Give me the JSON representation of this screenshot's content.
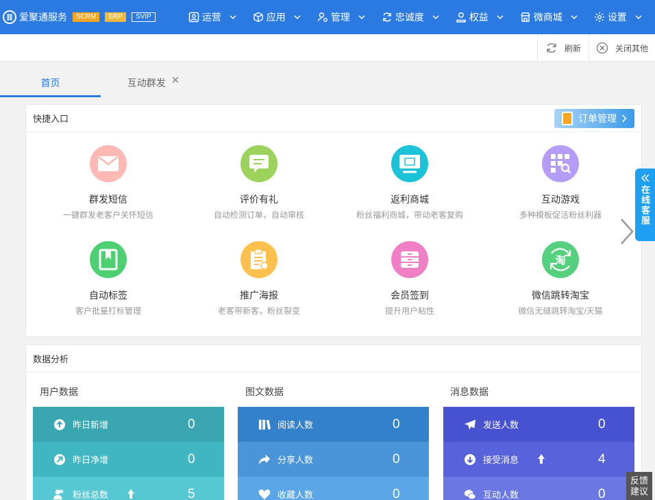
{
  "app": {
    "brand": "爱聚通服务",
    "badges": [
      "SCRM",
      "ERP",
      "SVIP"
    ]
  },
  "nav": [
    {
      "label": "运营",
      "icon": "user-card-icon"
    },
    {
      "label": "应用",
      "icon": "cube-icon"
    },
    {
      "label": "管理",
      "icon": "user-gear-icon"
    },
    {
      "label": "忠诚度",
      "icon": "refresh-icon"
    },
    {
      "label": "权益",
      "icon": "user-icon"
    },
    {
      "label": "微商城",
      "icon": "store-icon"
    },
    {
      "label": "设置",
      "icon": "gear-icon"
    }
  ],
  "toolbar": {
    "refresh_label": "刷新",
    "close_others_label": "关闭其他"
  },
  "tabs": [
    {
      "label": "首页",
      "active": true
    },
    {
      "label": "互动群发",
      "closable": true,
      "close_glyph": "✕"
    }
  ],
  "quick": {
    "title": "快捷入口",
    "order_button": "订单管理",
    "items": [
      {
        "title": "群发短信",
        "desc": "一键群发老客户关怀短信",
        "color": "#ffb9b4",
        "icon": "envelope-icon"
      },
      {
        "title": "评价有礼",
        "desc": "自动检测订单，自动审核",
        "color": "#9dd35d",
        "icon": "comment-icon"
      },
      {
        "title": "返利商城",
        "desc": "粉丝福利商城，带动老客复购",
        "color": "#1cc3d8",
        "icon": "monitor-icon"
      },
      {
        "title": "互动游戏",
        "desc": "多种模板促活粉丝利器",
        "color": "#b59cf7",
        "icon": "grid-search-icon"
      },
      {
        "title": "自动标签",
        "desc": "客户批量打标管理",
        "color": "#4dcf72",
        "icon": "bookmark-icon"
      },
      {
        "title": "推广海报",
        "desc": "老客带新客，粉丝裂变",
        "color": "#ffc04d",
        "icon": "clipboard-icon"
      },
      {
        "title": "会员签到",
        "desc": "提升用户粘性",
        "color": "#f07fc5",
        "icon": "cabinet-icon"
      },
      {
        "title": "微信跳转淘宝",
        "desc": "微信无缝跳转淘宝/天猫",
        "color": "#55d07e",
        "icon": "taobao-icon",
        "glyph": "淘"
      }
    ]
  },
  "float_service": {
    "label": "在线客服"
  },
  "feedback": {
    "line1": "反馈",
    "line2": "建议"
  },
  "analysis": {
    "title": "数据分析",
    "columns": [
      {
        "title": "用户数据",
        "rows": [
          {
            "label": "昨日新增",
            "value": "0",
            "color": "#3aa6b1",
            "icon": "arrow-up-circle-icon"
          },
          {
            "label": "昨日净增",
            "value": "0",
            "color": "#40b6c2",
            "icon": "arrow-diagonal-circle-icon"
          },
          {
            "label": "粉丝总数",
            "value": "5",
            "color": "#56c8d4",
            "icon": "users-icon",
            "trend": true
          }
        ]
      },
      {
        "title": "图文数据",
        "rows": [
          {
            "label": "阅读人数",
            "value": "0",
            "color": "#3481cb",
            "icon": "books-icon"
          },
          {
            "label": "分享人数",
            "value": "0",
            "color": "#4a95da",
            "icon": "share-arrow-icon"
          },
          {
            "label": "收藏人数",
            "value": "0",
            "color": "#5ba6e6",
            "icon": "heart-icon"
          }
        ]
      },
      {
        "title": "消息数据",
        "rows": [
          {
            "label": "发送人数",
            "value": "0",
            "color": "#4752d0",
            "icon": "paper-plane-icon"
          },
          {
            "label": "接受消息",
            "value": "4",
            "color": "#5862da",
            "icon": "arrow-down-circle-icon",
            "trend": true
          },
          {
            "label": "互动人数",
            "value": "0",
            "color": "#6b78e3",
            "icon": "chat-bubbles-icon"
          }
        ]
      }
    ]
  }
}
